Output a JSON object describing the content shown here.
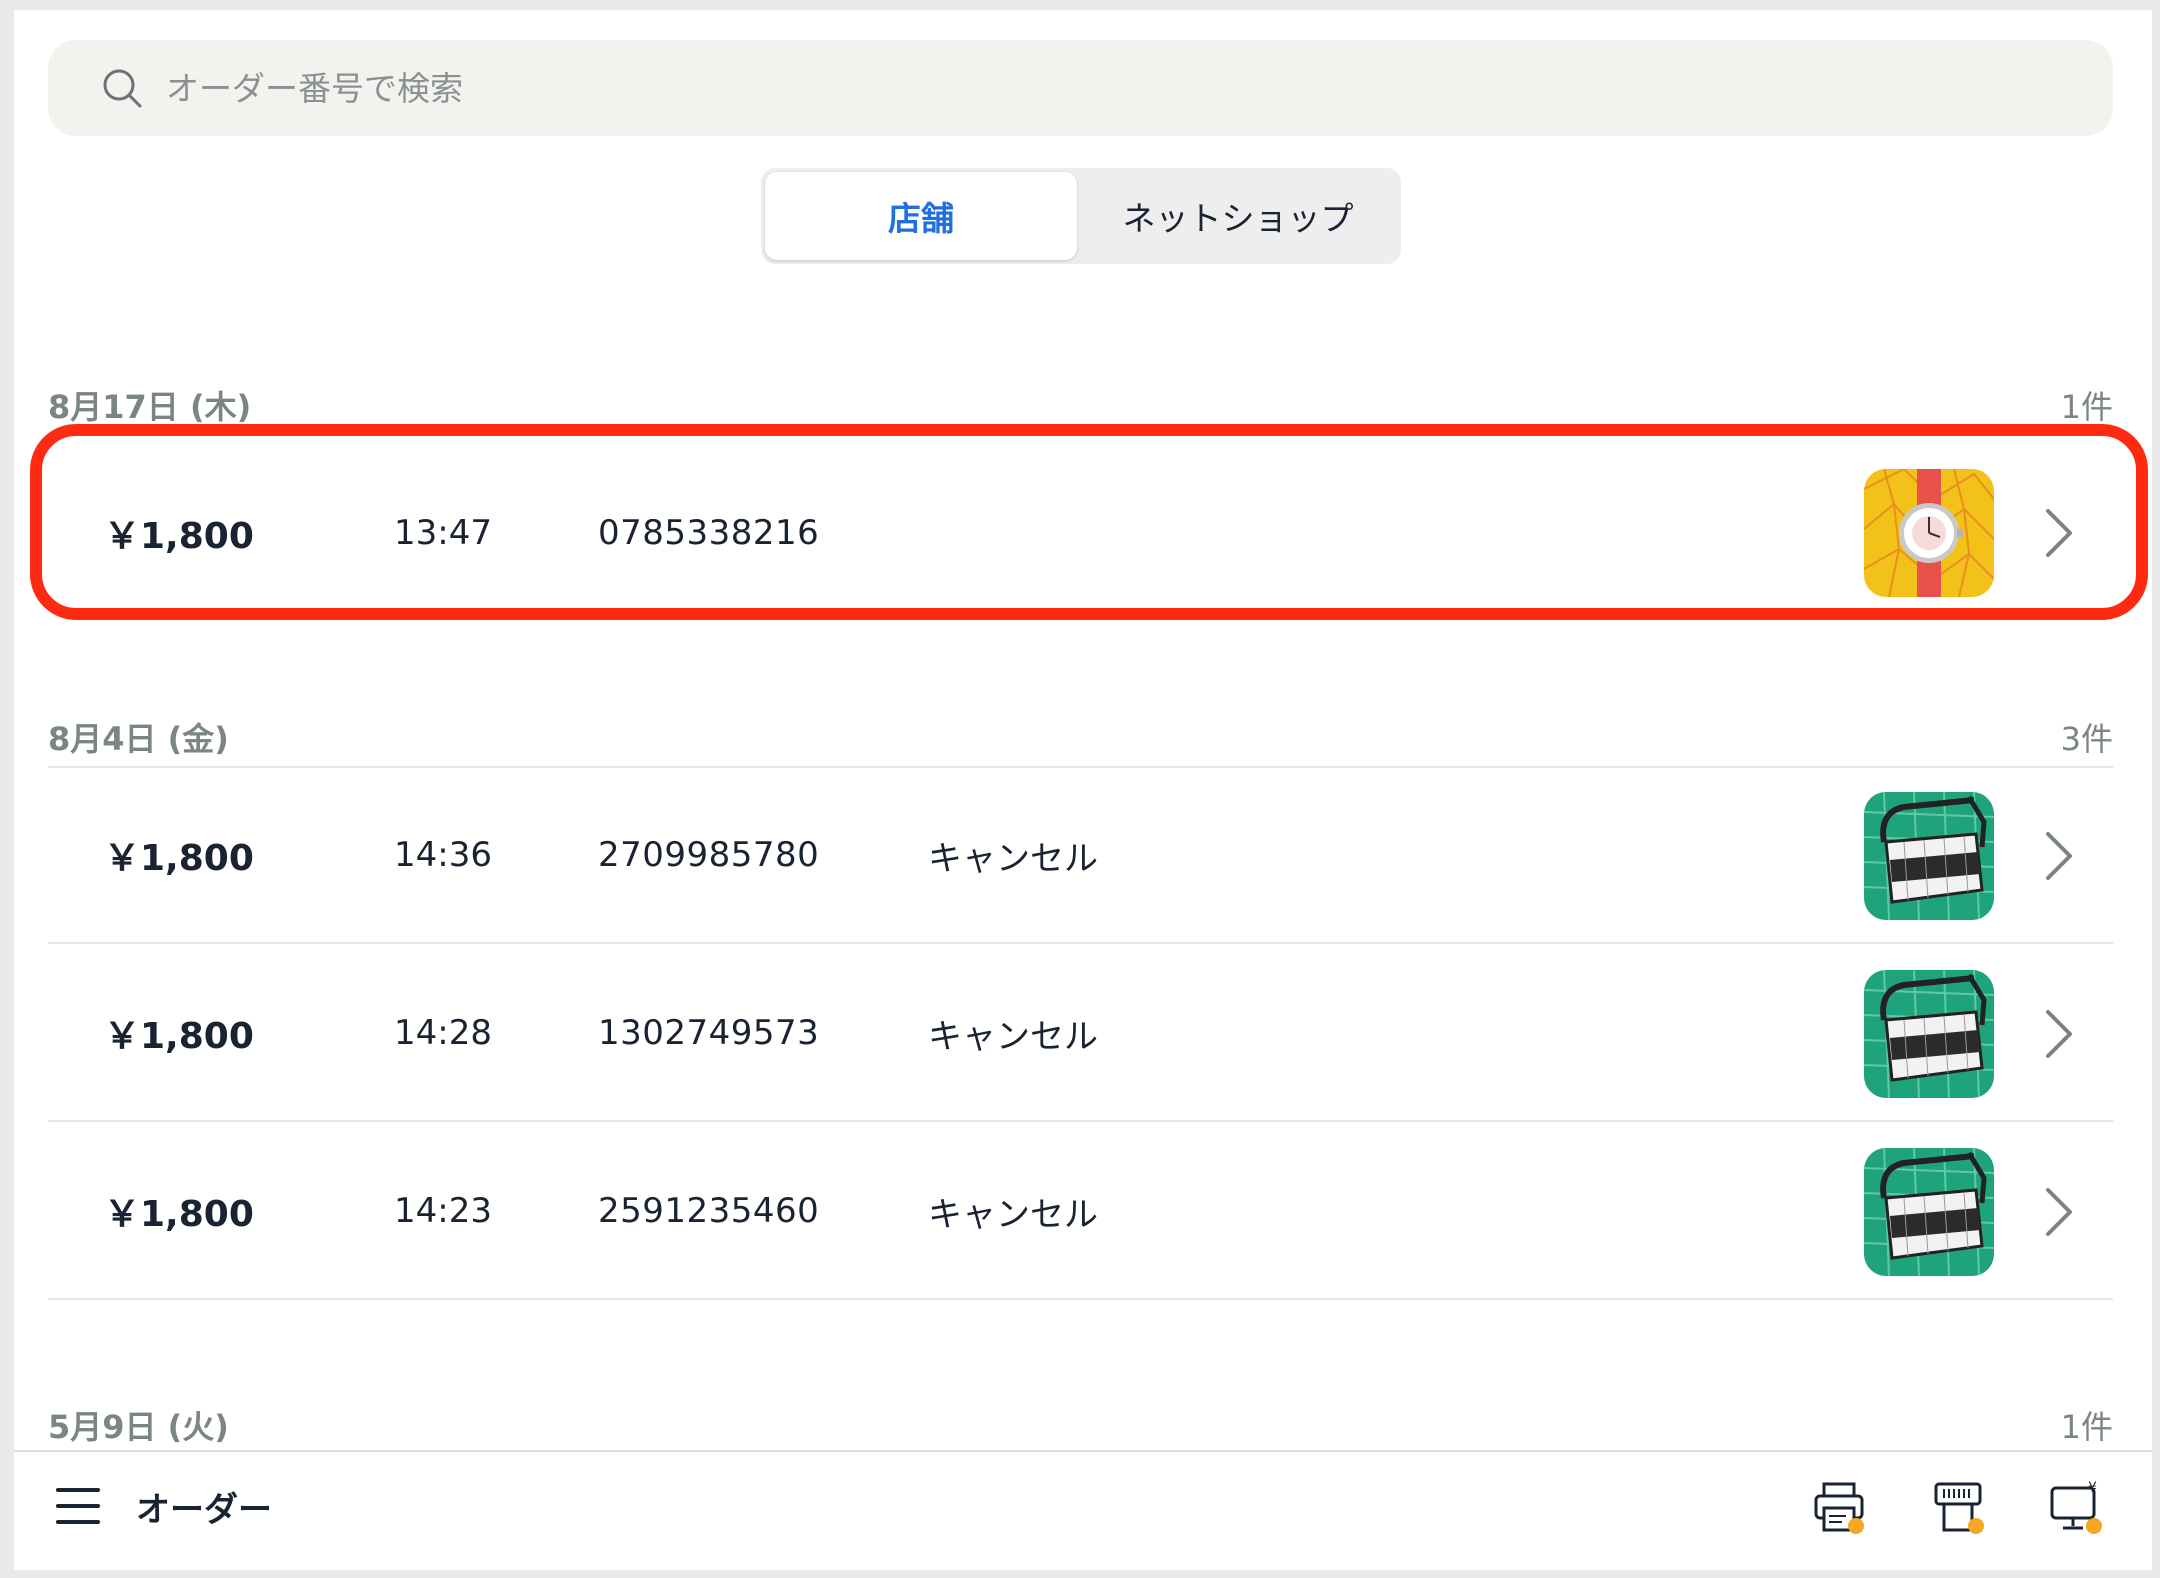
{
  "search": {
    "placeholder": "オーダー番号で検索"
  },
  "segment": {
    "tabs": [
      {
        "label": "店舗",
        "active": true
      },
      {
        "label": "ネットショップ",
        "active": false
      }
    ]
  },
  "sections": [
    {
      "date": "8月17日 (木)",
      "count": "1件",
      "orders": [
        {
          "price": "￥1,800",
          "time": "13:47",
          "order_no": "0785338216",
          "status": "",
          "thumb": "watch-thumbnail"
        }
      ]
    },
    {
      "date": "8月4日 (金)",
      "count": "3件",
      "orders": [
        {
          "price": "￥1,800",
          "time": "14:36",
          "order_no": "2709985780",
          "status": "キャンセル",
          "thumb": "bag-thumbnail"
        },
        {
          "price": "￥1,800",
          "time": "14:28",
          "order_no": "1302749573",
          "status": "キャンセル",
          "thumb": "bag-thumbnail"
        },
        {
          "price": "￥1,800",
          "time": "14:23",
          "order_no": "2591235460",
          "status": "キャンセル",
          "thumb": "bag-thumbnail"
        }
      ]
    },
    {
      "date": "5月9日 (火)",
      "count": "1件",
      "orders": []
    }
  ],
  "bottombar": {
    "title": "オーダー",
    "icons": [
      "printer-icon",
      "receipt-printer-icon",
      "cash-register-icon"
    ]
  },
  "colors": {
    "accent": "#1f6fe0",
    "highlight": "#ff2a12",
    "badge": "#f6a623",
    "thumb_watch_bg": "#f2c21a",
    "thumb_bag_bg": "#1fa37c"
  }
}
